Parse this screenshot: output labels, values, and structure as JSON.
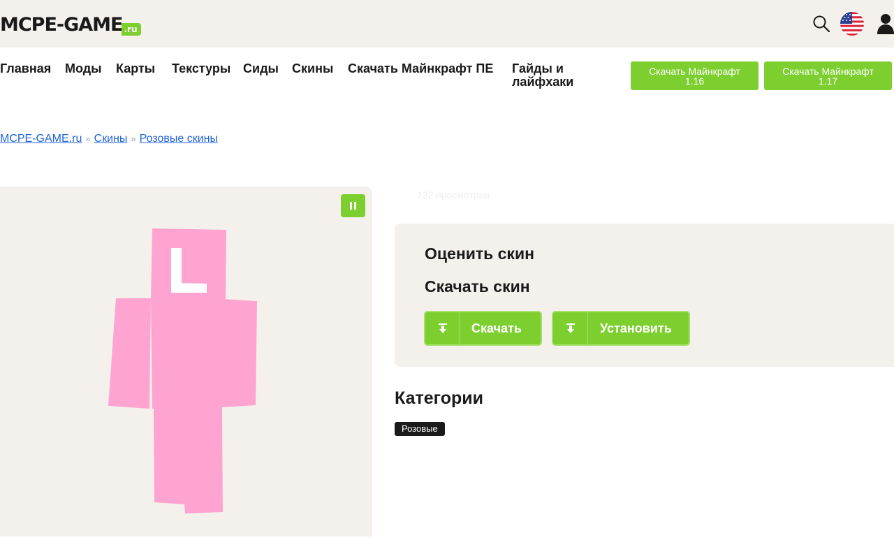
{
  "header": {
    "logo_text": "MCPE-GAME",
    "logo_suffix": ".ru",
    "icons": [
      "search-icon",
      "us-flag-icon",
      "user-icon"
    ]
  },
  "nav": {
    "items": [
      "Главная",
      "Моды",
      "Карты",
      "Текстуры",
      "Сиды",
      "Скины",
      "Скачать Майнкрафт ПЕ",
      "Гайды и лайфхаки"
    ],
    "buttons": [
      "Скачать Майнкрафт 1.16",
      "Скачать Майнкрафт 1.17"
    ]
  },
  "breadcrumb": {
    "items": [
      "MCPE-GAME.ru",
      "Скины",
      "Розовые скины"
    ],
    "separator": "»"
  },
  "preview": {
    "views": "132 просмотров",
    "icons": [
      "pause-icon"
    ]
  },
  "actions": {
    "rate_title": "Оценить скин",
    "download_title": "Скачать скин",
    "download_label": "Скачать",
    "install_label": "Установить"
  },
  "categories": {
    "title": "Категории",
    "tags": [
      "Розовые"
    ]
  },
  "colors": {
    "accent": "#7ccf2e",
    "panel": "#f4f1ec",
    "link": "#1f63d8",
    "skin": "#ffa3d1"
  }
}
